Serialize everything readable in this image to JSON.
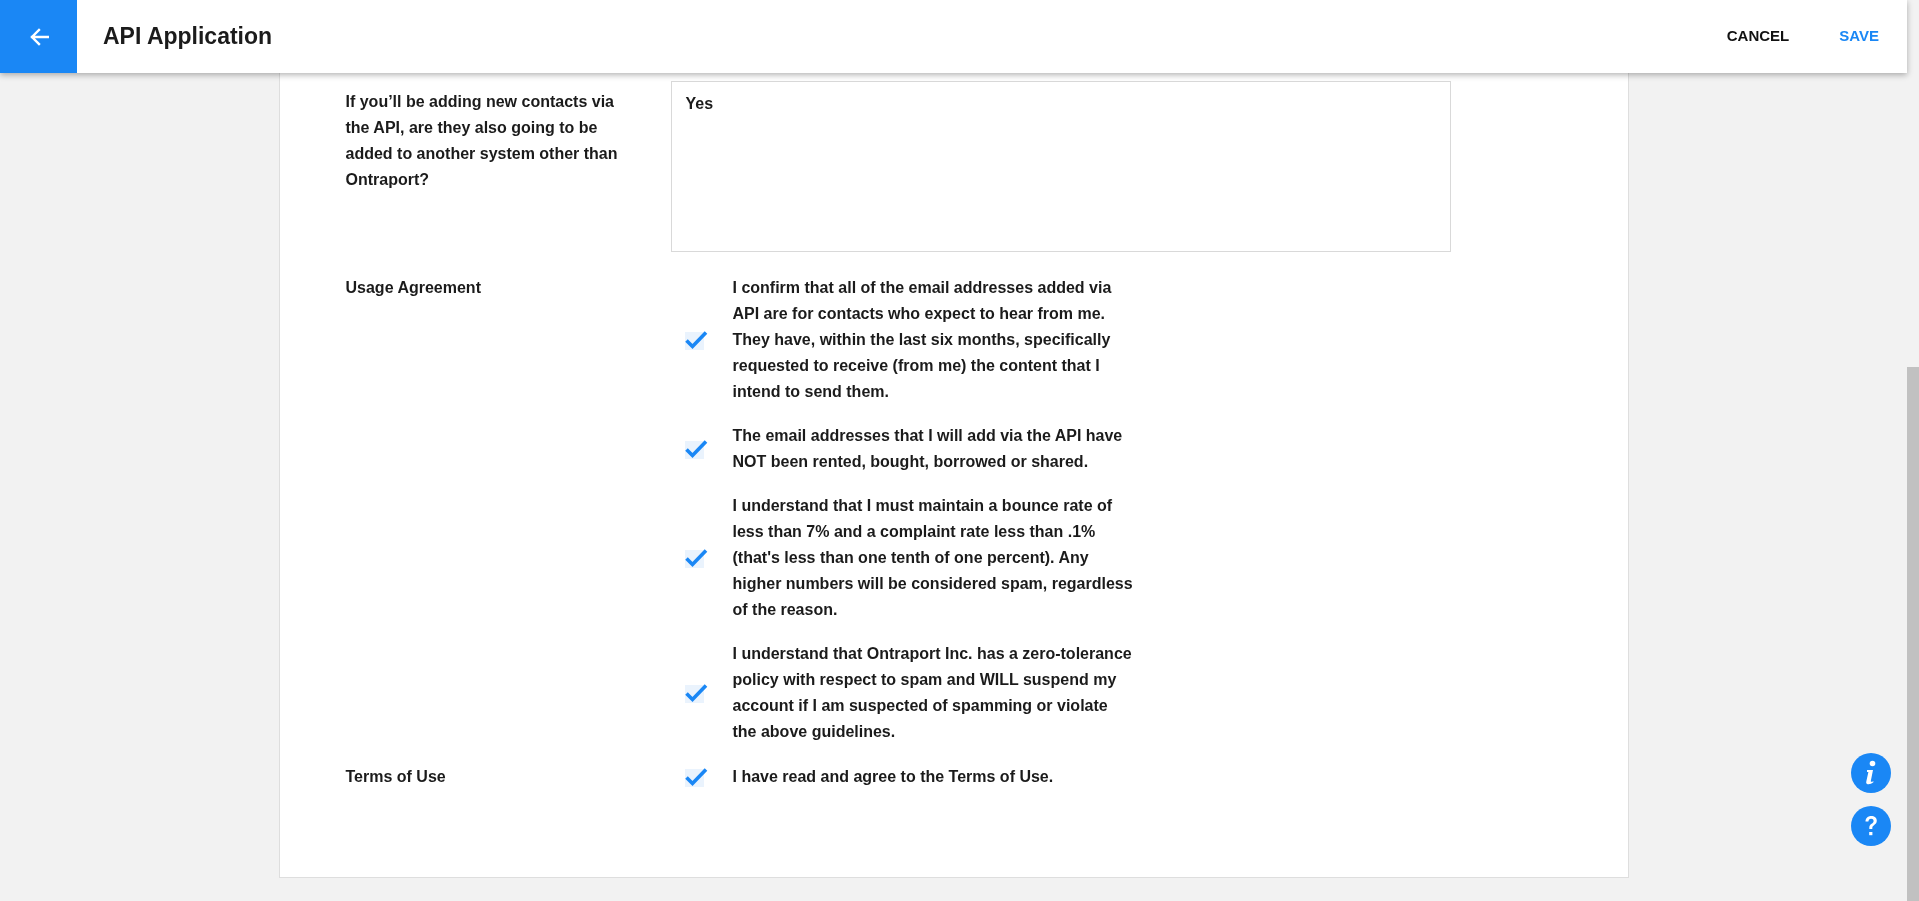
{
  "header": {
    "title": "API Application",
    "actions": [
      {
        "label": "CANCEL",
        "kind": "secondary"
      },
      {
        "label": "SAVE",
        "kind": "primary"
      }
    ]
  },
  "form": {
    "fields": [
      {
        "kind": "textarea",
        "label": "If you’ll be adding new contacts via the API, are they also going to be added to another system other than Ontraport?",
        "value": "Yes"
      },
      {
        "kind": "checklist",
        "label": "Usage Agreement",
        "items": [
          {
            "text": "I confirm that all of the email addresses added via API are for contacts who expect to hear from me. They have, within the last six months, specifically requested to receive (from me) the content that I intend to send them.",
            "checked": true
          },
          {
            "text": "The email addresses that I will add via the API have NOT been rented, bought, borrowed or shared.",
            "checked": true
          },
          {
            "text": "I understand that I must maintain a bounce rate of less than 7% and a complaint rate less than .1% (that's less than one tenth of one percent). Any higher numbers will be considered spam, regardless of the reason.",
            "checked": true
          },
          {
            "text": "I understand that Ontraport Inc. has a zero-tolerance policy with respect to spam and WILL suspend my account if I am suspected of spamming or violate the above guidelines.",
            "checked": true
          }
        ]
      },
      {
        "kind": "checklist",
        "label": "Terms of Use",
        "items": [
          {
            "text": "I have read and agree to the Terms of Use.",
            "checked": true
          }
        ]
      }
    ]
  }
}
